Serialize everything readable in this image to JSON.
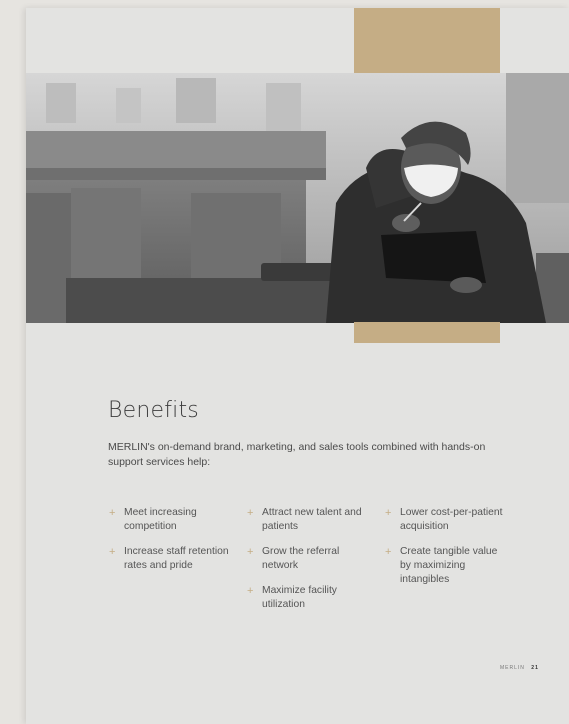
{
  "section": {
    "title": "Benefits",
    "intro": "MERLIN's on-demand brand, marketing, and sales tools combined with hands-on support services help:"
  },
  "benefits": {
    "col1": [
      "Meet increasing competition",
      "Increase staff retention rates and pride"
    ],
    "col2": [
      "Attract new talent and patients",
      "Grow the referral network",
      "Maximize facility utilization"
    ],
    "col3": [
      "Lower cost-per-patient acquisition",
      "Create tangible value by maximizing intangibles"
    ]
  },
  "bullet_symbol": "+",
  "footer": {
    "brand": "MERLIN",
    "page_number": "21"
  },
  "colors": {
    "accent_gold": "#c5ad85",
    "page": "#e3e3e1"
  },
  "photo": {
    "description_icon": "woman-writing-photo"
  }
}
